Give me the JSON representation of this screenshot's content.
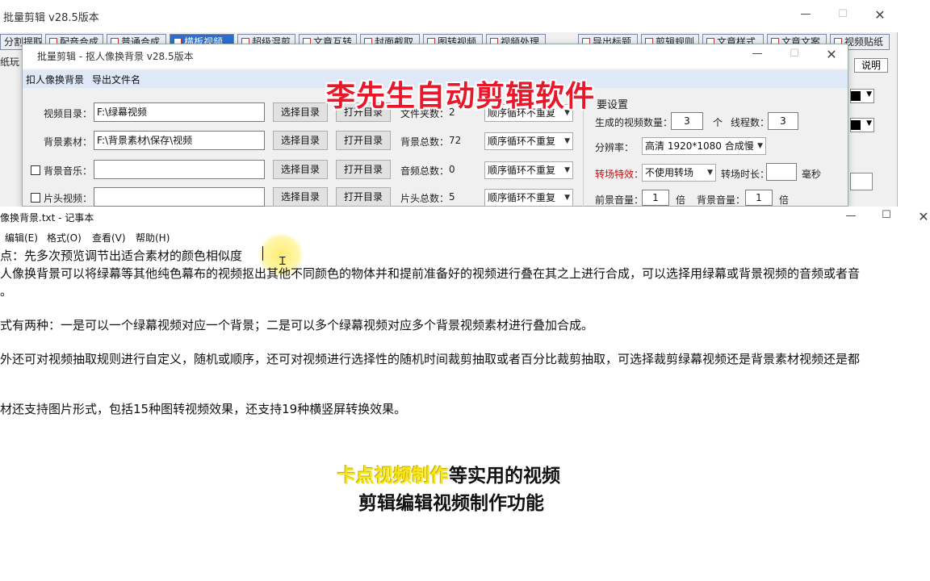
{
  "main_window": {
    "title": "批量剪辑   v28.5版本",
    "tabs": [
      "分割提取",
      "配音合成",
      "普通合成",
      "横板视频",
      "超级混剪",
      "文章互转",
      "封面截取",
      "图转视频",
      "视频处理",
      "导出标题",
      "剪辑规则",
      "文章样式",
      "文章文案",
      "视频贴纸"
    ],
    "side_label": "纸玩",
    "help_label": "说明",
    "colors": {
      "active_tab": "#2a6fcf"
    }
  },
  "dialog": {
    "title": "批量剪辑  -  抠人像换背景   v28.5版本",
    "menu": [
      "扣人像换背景",
      "导出文件名"
    ],
    "rows": [
      {
        "label": "视频目录：",
        "value": "F:\\绿幕视频",
        "select_btn": "选择目录",
        "open_btn": "打开目录",
        "count_label": "文件夹数：",
        "count": "2",
        "mode": "顺序循环不重复"
      },
      {
        "label": "背景素材：",
        "value": "F:\\背景素材\\保存\\视频",
        "select_btn": "选择目录",
        "open_btn": "打开目录",
        "count_label": "背景总数：",
        "count": "72",
        "mode": "顺序循环不重复"
      },
      {
        "label": "背景音乐：",
        "value": "",
        "select_btn": "选择目录",
        "open_btn": "打开目录",
        "count_label": "音频总数：",
        "count": "0",
        "mode": "顺序循环不重复"
      },
      {
        "label": "片头视频：",
        "value": "",
        "select_btn": "选择目录",
        "open_btn": "打开目录",
        "count_label": "片头总数：",
        "count": "5",
        "mode": "顺序循环不重复"
      }
    ],
    "settings": {
      "group_title": "要设置",
      "gen_count_label": "生成的视频数量：",
      "gen_count": "3",
      "gen_unit": "个",
      "threads_label": "线程数：",
      "threads": "3",
      "resolution_label": "分辨率：",
      "resolution": "高清 1920*1080 合成慢",
      "transition_label": "转场特效：",
      "transition": "不使用转场",
      "transition_dur_label": "转场时长：",
      "transition_dur": "",
      "transition_unit": "毫秒",
      "fg_volume_label": "前景音量：",
      "fg_volume": "1",
      "fg_unit": "倍",
      "bg_volume_label": "背景音量：",
      "bg_volume": "1",
      "bg_unit": "倍"
    }
  },
  "notepad": {
    "title": "像换背景.txt - 记事本",
    "menu": [
      "编辑(E)",
      "格式(O)",
      "查看(V)",
      "帮助(H)"
    ],
    "lines": [
      "点：先多次预览调节出适合素材的颜色相似度",
      "人像换背景可以将绿幕等其他纯色幕布的视频抠出其他不同颜色的物体并和提前准备好的视频进行叠在其之上进行合成，可以选择用绿幕或背景视频的音频或者音",
      "。",
      "式有两种：一是可以一个绿幕视频对应一个背景；二是可以多个绿幕视频对应多个背景视频素材进行叠加合成。",
      "外还可对视频抽取规则进行自定义，随机或顺序，还可对视频进行选择性的随机时间裁剪抽取或者百分比裁剪抽取，可选择裁剪绿幕视频还是背景素材视频还是都",
      "材还支持图片形式，包括15种图转视频效果，还支持19种横竖屏转换效果。"
    ]
  },
  "overlay": {
    "watermark": "李先生自动剪辑软件",
    "subtitle_line1_highlight": "卡点视频制作",
    "subtitle_line1_rest": "等实用的视频",
    "subtitle_line2": "剪辑编辑视频制作功能",
    "colors": {
      "watermark": "#e8182a",
      "highlight": "#f4e51c"
    }
  }
}
